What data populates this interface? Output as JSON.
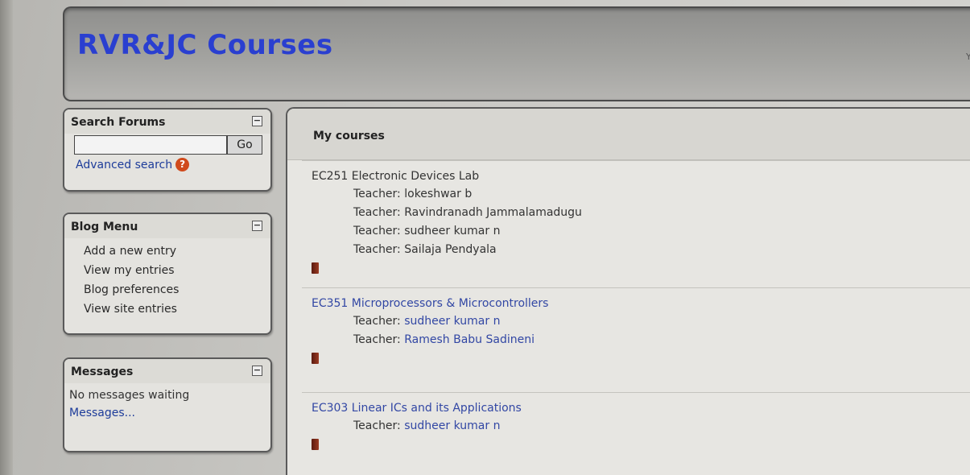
{
  "header": {
    "site_title": "RVR&JC Courses",
    "right_fragment": "Yo"
  },
  "search_block": {
    "title": "Search Forums",
    "collapse_symbol": "−",
    "input_value": "",
    "go_label": "Go",
    "advanced_label": "Advanced search",
    "help_symbol": "?"
  },
  "blog_block": {
    "title": "Blog Menu",
    "collapse_symbol": "−",
    "items": [
      {
        "label": "Add a new entry"
      },
      {
        "label": "View my entries"
      },
      {
        "label": "Blog preferences"
      },
      {
        "label": "View site entries"
      }
    ]
  },
  "messages_block": {
    "title": "Messages",
    "collapse_symbol": "−",
    "status": "No messages waiting",
    "link": "Messages..."
  },
  "main": {
    "title": "My courses",
    "teacher_label": "Teacher:",
    "courses": [
      {
        "title": "EC251 Electronic Devices Lab",
        "teachers": [
          "lokeshwar b",
          "Ravindranadh Jammalamadugu",
          "sudheer kumar n",
          "Sailaja Pendyala"
        ]
      },
      {
        "title": "EC351 Microprocessors & Microcontrollers",
        "teachers": [
          "sudheer kumar n",
          "Ramesh Babu Sadineni"
        ]
      },
      {
        "title": "EC303 Linear ICs and its Applications",
        "teachers": [
          "sudheer kumar n"
        ]
      }
    ]
  },
  "colors": {
    "title_blue": "#2a3fd0",
    "link_blue": "#3247a4",
    "help_orange": "#d04a1c"
  }
}
